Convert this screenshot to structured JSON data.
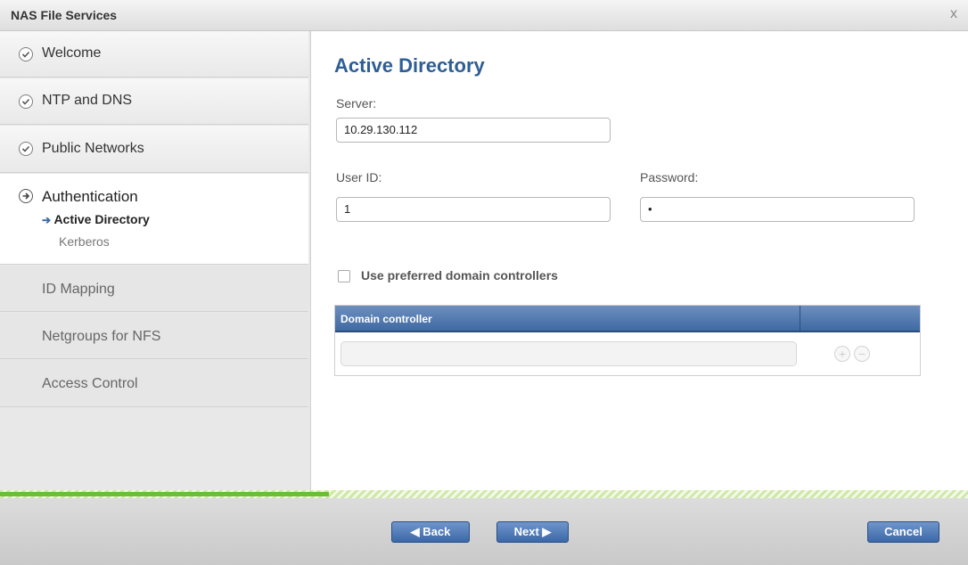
{
  "window": {
    "title": "NAS File Services",
    "close_glyph": "x"
  },
  "sidebar": {
    "steps": [
      {
        "label": "Welcome",
        "state": "done"
      },
      {
        "label": "NTP and DNS",
        "state": "done"
      },
      {
        "label": "Public Networks",
        "state": "done"
      },
      {
        "label": "Authentication",
        "state": "active",
        "substeps": [
          {
            "label": "Active Directory",
            "current": true
          },
          {
            "label": "Kerberos"
          }
        ]
      },
      {
        "label": "ID Mapping",
        "state": "pending"
      },
      {
        "label": "Netgroups for NFS",
        "state": "pending"
      },
      {
        "label": "Access Control",
        "state": "pending"
      }
    ]
  },
  "main": {
    "heading": "Active Directory",
    "server": {
      "label": "Server:",
      "value": "10.29.130.112"
    },
    "user_id": {
      "label": "User ID:",
      "value": "1"
    },
    "password": {
      "label": "Password:",
      "value": "•"
    },
    "preferred_dc": {
      "label": "Use preferred domain controllers",
      "checked": false
    },
    "dc_table": {
      "column": "Domain controller",
      "add_glyph": "+",
      "remove_glyph": "−"
    }
  },
  "progress": {
    "fraction": 0.34
  },
  "footer": {
    "back_label": "◀ Back",
    "next_label": "Next ▶",
    "cancel_label": "Cancel"
  },
  "colors": {
    "accent": "#2f5e96",
    "button": "#4a74b4",
    "progress": "#6bbd3a"
  }
}
